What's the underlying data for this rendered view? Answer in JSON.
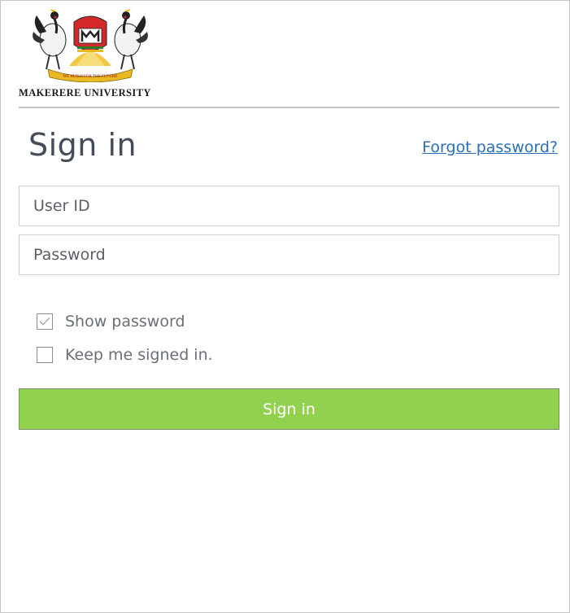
{
  "brand": {
    "university_name": "MAKERERE UNIVERSITY",
    "motto": "WE BUILD FOR THE FUTURE"
  },
  "header": {
    "title": "Sign in",
    "forgot_password": "Forgot password?"
  },
  "form": {
    "user_id": {
      "placeholder": "User ID",
      "value": ""
    },
    "password": {
      "placeholder": "Password",
      "value": ""
    },
    "show_password": {
      "label": "Show password",
      "checked": true
    },
    "keep_signed_in": {
      "label": "Keep me signed in.",
      "checked": false
    },
    "submit_label": "Sign in"
  },
  "colors": {
    "button": "#92d14f",
    "link": "#2a6fb7",
    "title": "#454c59",
    "crest_red": "#d4282a",
    "crest_gold": "#e8b923"
  }
}
